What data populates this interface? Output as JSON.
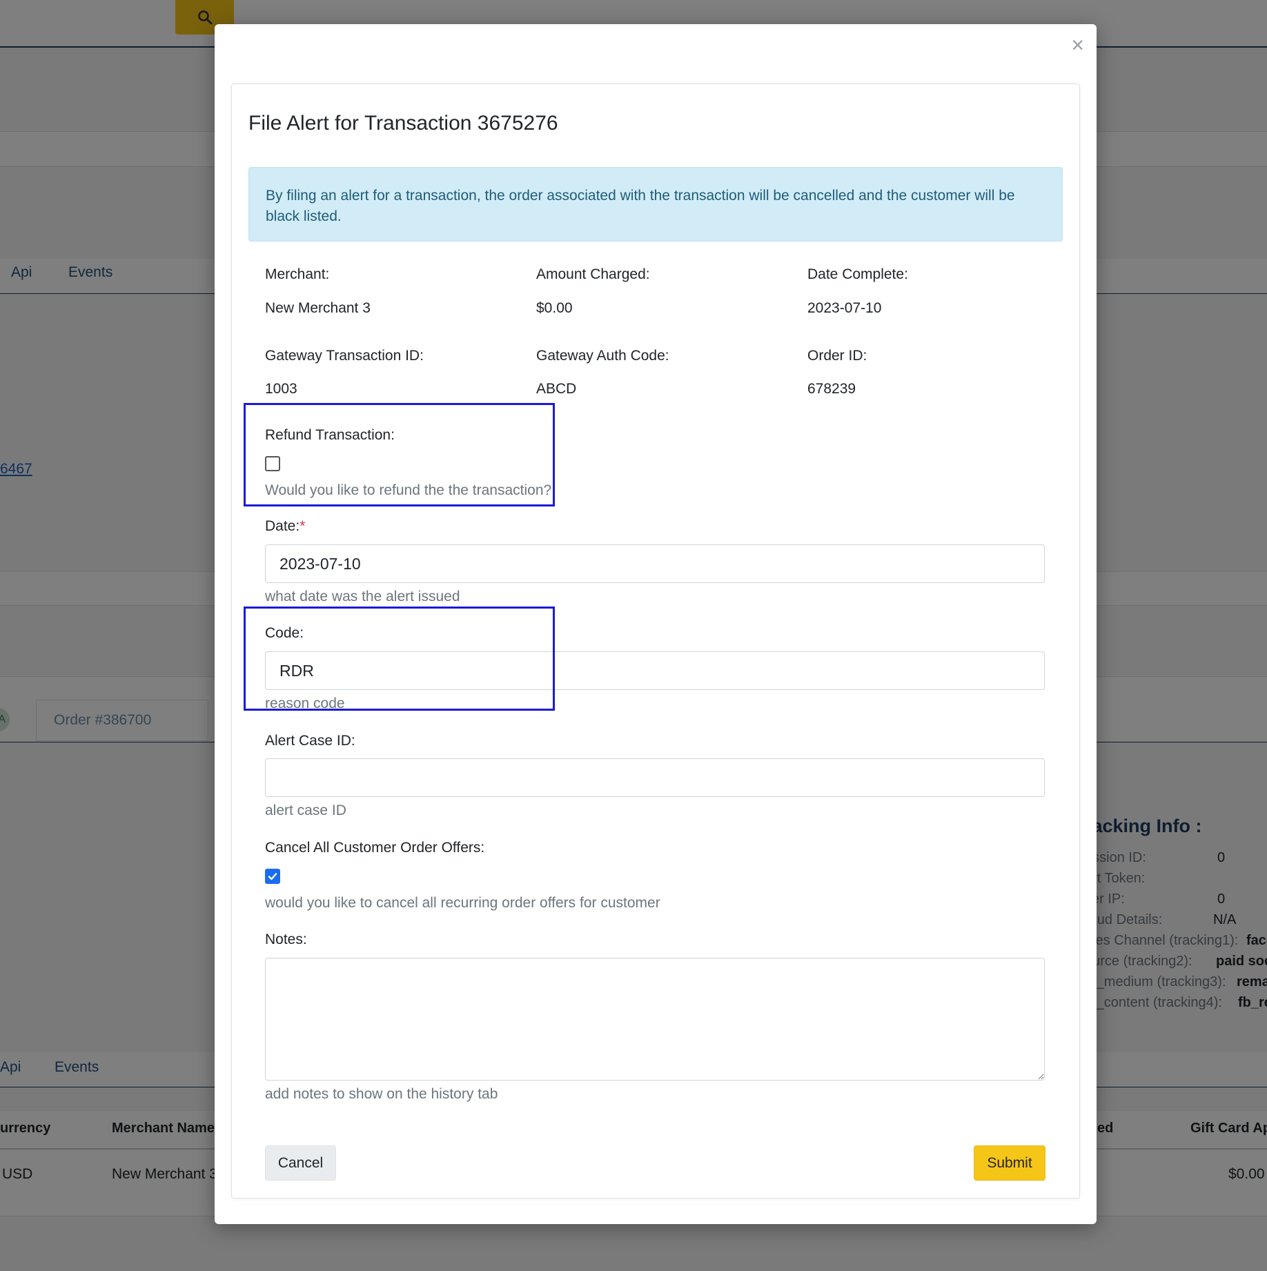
{
  "background": {
    "tabs_top": [
      "Api",
      "Events"
    ],
    "link_text": "6467",
    "order_tab": "Order #386700",
    "avatar_initial": "A",
    "tracking": {
      "title": "racking Info :",
      "rows": [
        {
          "label": "ession ID:",
          "value": "0"
        },
        {
          "label": "art Token:",
          "value": ""
        },
        {
          "label": "ser IP:",
          "value": "0"
        },
        {
          "label": "raud Details:",
          "value": "N/A"
        },
        {
          "label": "ales Channel (tracking1):",
          "value": "face"
        },
        {
          "label": "ource (tracking2):",
          "value": "paid soc"
        },
        {
          "label": "m_medium (tracking3):",
          "value": "rema"
        },
        {
          "label": "m_content (tracking4):",
          "value": "fb_re"
        }
      ]
    },
    "tabs_bottom": [
      "Api",
      "Events"
    ],
    "table": {
      "headers": [
        "urrency",
        "Merchant Name",
        "ed",
        "Gift Card Ap"
      ],
      "row": [
        "USD",
        "New Merchant 3",
        "",
        "$0.00"
      ]
    }
  },
  "modal": {
    "close_symbol": "×",
    "title": "File Alert for Transaction 3675276",
    "alert_text": "By filing an alert for a transaction, the order associated with the transaction will be cancelled and the customer will be black listed.",
    "info": [
      {
        "label": "Merchant:",
        "value": "New Merchant 3"
      },
      {
        "label": "Amount Charged:",
        "value": "$0.00"
      },
      {
        "label": "Date Complete:",
        "value": "2023-07-10"
      },
      {
        "label": "Gateway Transaction ID:",
        "value": "1003"
      },
      {
        "label": "Gateway Auth Code:",
        "value": "ABCD"
      },
      {
        "label": "Order ID:",
        "value": "678239"
      }
    ],
    "refund": {
      "label": "Refund Transaction:",
      "checked": false,
      "help": "Would you like to refund the the transaction?"
    },
    "date": {
      "label": "Date:",
      "required_mark": "*",
      "value": "2023-07-10",
      "help": "what date was the alert issued"
    },
    "code": {
      "label": "Code:",
      "value": "RDR",
      "help": "reason code"
    },
    "alert_case": {
      "label": "Alert Case ID:",
      "value": "",
      "help": "alert case ID"
    },
    "cancel_offers": {
      "label": "Cancel All Customer Order Offers:",
      "checked": true,
      "help": "would you like to cancel all recurring order offers for customer"
    },
    "notes": {
      "label": "Notes:",
      "value": "",
      "help": "add notes to show on the history tab"
    },
    "buttons": {
      "cancel": "Cancel",
      "submit": "Submit"
    }
  },
  "colors": {
    "accent_yellow": "#f5c518",
    "info_bg": "#d1ecf7",
    "info_text": "#1f5c78",
    "highlight_box": "#1a1ad9",
    "checkbox_checked": "#1a6cf0"
  }
}
